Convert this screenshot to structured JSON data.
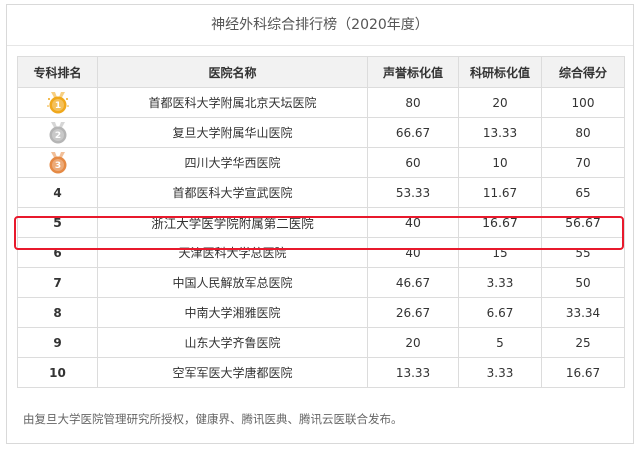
{
  "title": "神经外科综合排行榜（2020年度）",
  "columns": [
    "专科排名",
    "医院名称",
    "声誉标化值",
    "科研标化值",
    "综合得分"
  ],
  "rows": [
    {
      "rank": "",
      "medal": "gold",
      "medal_num": "1",
      "hospital": "首都医科大学附属北京天坛医院",
      "reputation": "80",
      "research": "20",
      "score": "100"
    },
    {
      "rank": "",
      "medal": "silver",
      "medal_num": "2",
      "hospital": "复旦大学附属华山医院",
      "reputation": "66.67",
      "research": "13.33",
      "score": "80"
    },
    {
      "rank": "",
      "medal": "bronze",
      "medal_num": "3",
      "hospital": "四川大学华西医院",
      "reputation": "60",
      "research": "10",
      "score": "70"
    },
    {
      "rank": "4",
      "hospital": "首都医科大学宣武医院",
      "reputation": "53.33",
      "research": "11.67",
      "score": "65"
    },
    {
      "rank": "5",
      "hospital": "浙江大学医学院附属第二医院",
      "reputation": "40",
      "research": "16.67",
      "score": "56.67",
      "highlight": true
    },
    {
      "rank": "6",
      "hospital": "天津医科大学总医院",
      "reputation": "40",
      "research": "15",
      "score": "55"
    },
    {
      "rank": "7",
      "hospital": "中国人民解放军总医院",
      "reputation": "46.67",
      "research": "3.33",
      "score": "50"
    },
    {
      "rank": "8",
      "hospital": "中南大学湘雅医院",
      "reputation": "26.67",
      "research": "6.67",
      "score": "33.34"
    },
    {
      "rank": "9",
      "hospital": "山东大学齐鲁医院",
      "reputation": "20",
      "research": "5",
      "score": "25"
    },
    {
      "rank": "10",
      "hospital": "空军军医大学唐都医院",
      "reputation": "13.33",
      "research": "3.33",
      "score": "16.67"
    }
  ],
  "medal_colors": {
    "gold": "#f0a81c",
    "silver": "#b5b5b5",
    "bronze": "#e58a45"
  },
  "highlight_color": "#e8192c",
  "footer": "由复旦大学医院管理研究所授权，健康界、腾讯医典、腾讯云医联合发布。"
}
